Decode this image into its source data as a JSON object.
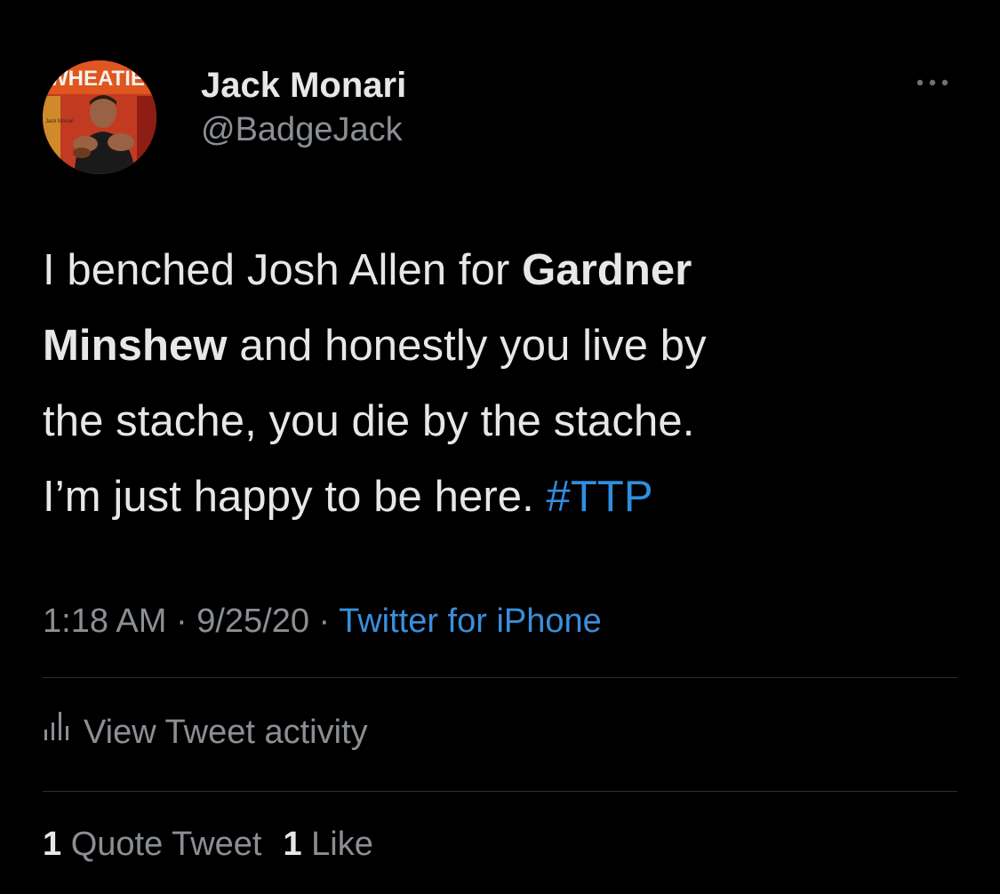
{
  "author": {
    "display_name": "Jack Monari",
    "handle": "@BadgeJack",
    "avatar_icon": "wheaties-box-avatar",
    "avatar_text": "WHEATIES",
    "avatar_small_text": "Jack Monari"
  },
  "more_icon": "more-horizontal-icon",
  "tweet": {
    "line1_plain": "I benched Josh Allen for ",
    "line1_bold": "Gardner",
    "line2_bold": "Minshew",
    "line2_plain": " and honestly you live by",
    "line3": "the stache, you die by the stache.",
    "line4_plain": "I’m just happy to be here. ",
    "hashtag": "#TTP"
  },
  "meta": {
    "time": "1:18 AM",
    "sep1": " · ",
    "date": "9/25/20",
    "sep2": " · ",
    "source": "Twitter for iPhone"
  },
  "activity": {
    "label": "View Tweet activity",
    "icon": "activity-chart-icon"
  },
  "stats": {
    "quote_count": "1",
    "quote_label": " Quote Tweet",
    "like_count": "1",
    "like_label": " Like"
  },
  "colors": {
    "background": "#000000",
    "text_primary": "#e7e7e7",
    "text_secondary": "#8b8f94",
    "accent_blue": "#2f8ee0",
    "divider": "#2b2f33"
  }
}
